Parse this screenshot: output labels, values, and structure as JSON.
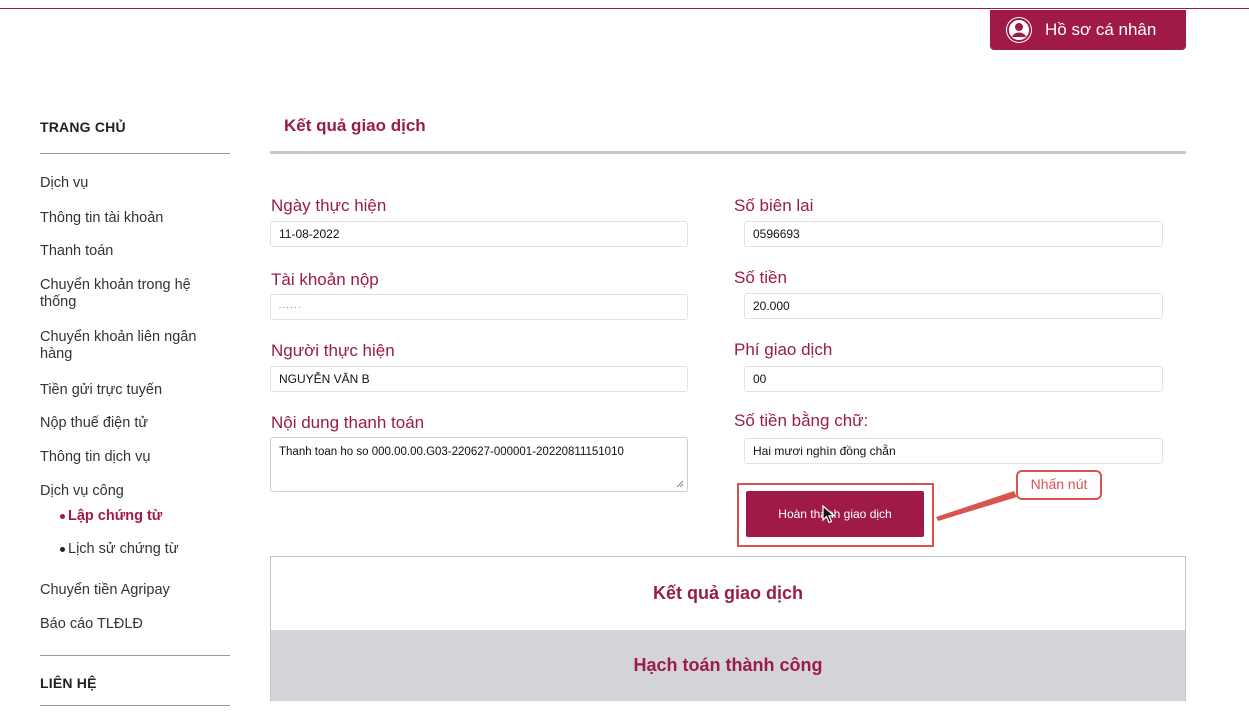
{
  "header": {
    "profile_label": "Hồ sơ cá nhân",
    "accent_color": "#a01a49"
  },
  "sidebar": {
    "home_heading": "TRANG CHỦ",
    "items": [
      {
        "label": "Dịch vụ"
      },
      {
        "label": "Thông tin tài khoản"
      },
      {
        "label": "Thanh toán"
      },
      {
        "label": "Chuyển khoản trong hệ thống"
      },
      {
        "label": "Chuyển khoản liên ngân hàng"
      },
      {
        "label": "Tiền gửi trực tuyến"
      },
      {
        "label": "Nộp thuế điện tử"
      },
      {
        "label": "Thông tin dịch vụ"
      },
      {
        "label": "Dịch vụ công"
      }
    ],
    "sub_items": [
      {
        "label": "Lập chứng từ",
        "active": true
      },
      {
        "label": "Lịch sử chứng từ",
        "active": false
      }
    ],
    "more_items": [
      {
        "label": "Chuyển tiền Agripay"
      },
      {
        "label": "Báo cáo TLĐLĐ"
      }
    ],
    "contact_heading": "LIÊN HỆ"
  },
  "main": {
    "title": "Kết quả giao dịch",
    "fields": {
      "date_label": "Ngày thực hiện",
      "date_value": "11-08-2022",
      "receipt_label": "Số biên lai",
      "receipt_value": "0596693",
      "account_label": "Tài khoản nộp",
      "account_value": ". . . . . .",
      "amount_label": "Số tiền",
      "amount_value": "20.000",
      "person_label": "Người thực hiện",
      "person_value": "NGUYỄN VĂN B",
      "fee_label": "Phí giao dịch",
      "fee_value": "00",
      "content_label": "Nội dung thanh toán",
      "content_value": "Thanh toan ho so 000.00.00.G03-220627-000001-20220811151010",
      "words_label": "Số tiền bằng chữ:",
      "words_value": "Hai mươi nghìn đồng chẵn"
    },
    "finish_button": "Hoàn thành giao dịch",
    "callout": "Nhấn nút",
    "result_heading": "Kết quả giao dịch",
    "result_status": "Hạch toán thành công"
  }
}
